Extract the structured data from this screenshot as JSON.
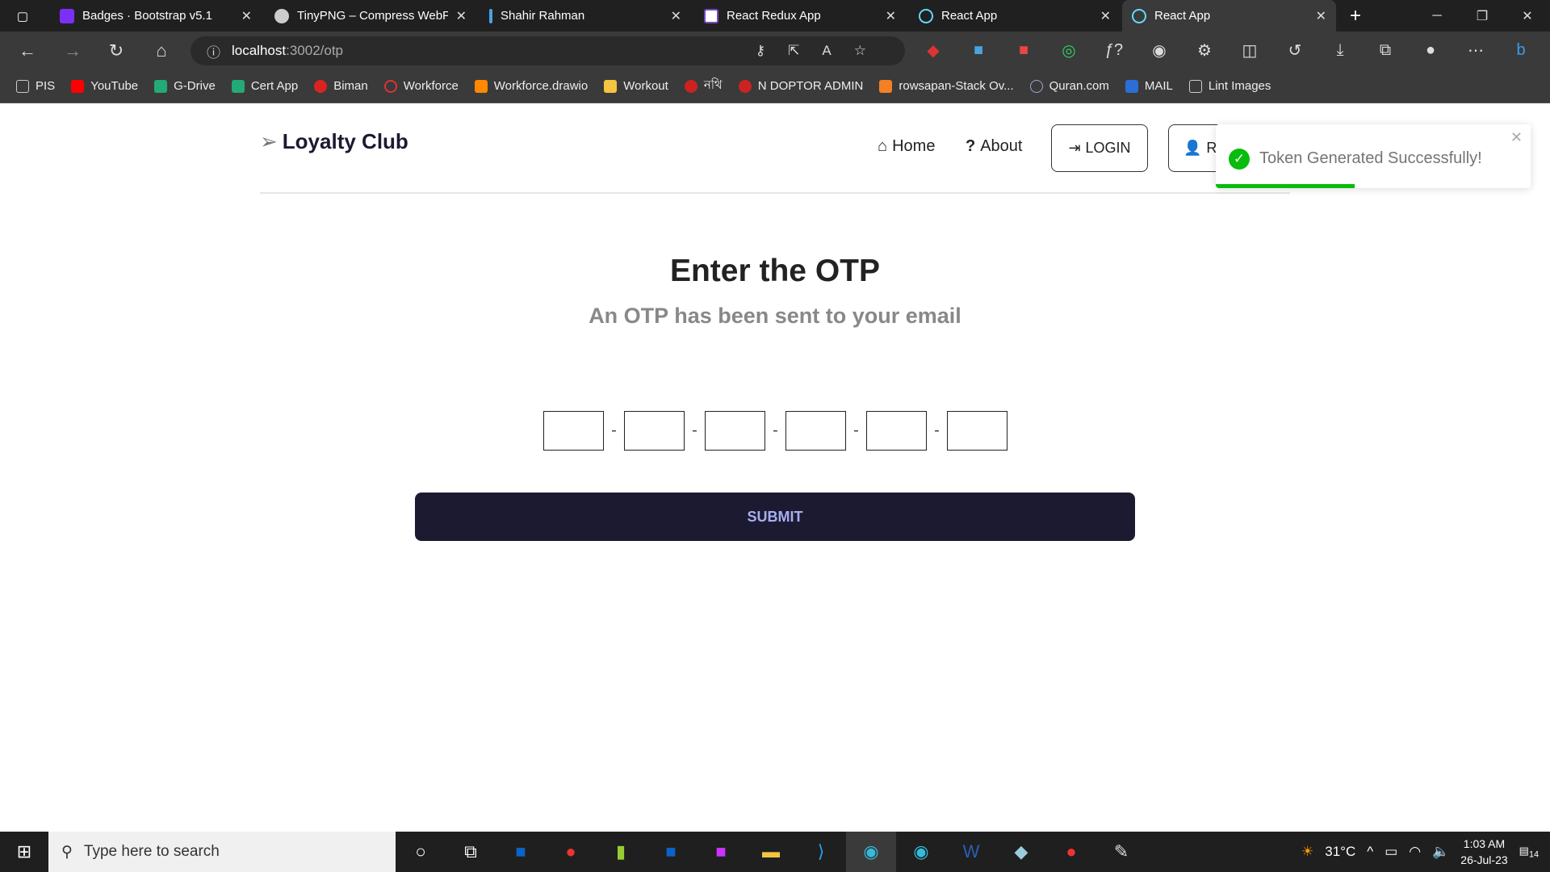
{
  "browser": {
    "tabs": [
      {
        "title": "Badges · Bootstrap v5.1",
        "icon_color": "#7b2ff7"
      },
      {
        "title": "TinyPNG – Compress WebP,",
        "icon_color": "#ccc"
      },
      {
        "title": "Shahir Rahman",
        "icon_color": "#4aa3df"
      },
      {
        "title": "React Redux App",
        "icon_color": "#764abc"
      },
      {
        "title": "React App",
        "icon_color": "#61dafb"
      },
      {
        "title": "React App",
        "icon_color": "#61dafb",
        "active": true
      }
    ],
    "url_host": "localhost",
    "url_path": ":3002/otp",
    "bookmarks": [
      "PIS",
      "YouTube",
      "G-Drive",
      "Cert App",
      "Biman",
      "Workforce",
      "Workforce.drawio",
      "Workout",
      "নথি",
      "N DOPTOR ADMIN",
      "rowsapan-Stack Ov...",
      "Quran.com",
      "MAIL",
      "Lint Images"
    ]
  },
  "header": {
    "logo": "Loyalty Club",
    "home": "Home",
    "about": "About",
    "login": "LOGIN",
    "register": "R"
  },
  "toast": {
    "message": "Token Generated Successfully!",
    "progress": 0.44,
    "color": "#07bc0c"
  },
  "main": {
    "title": "Enter the OTP",
    "subtitle": "An OTP has been sent to your email",
    "otp_values": [
      "",
      "",
      "",
      "",
      "",
      ""
    ],
    "separator": "-",
    "submit": "SUBMIT",
    "accent": "#1b1a30"
  },
  "taskbar": {
    "search_placeholder": "Type here to search",
    "temperature": "31°C",
    "time": "1:03 AM",
    "date": "26-Jul-23",
    "notifications": "14"
  }
}
